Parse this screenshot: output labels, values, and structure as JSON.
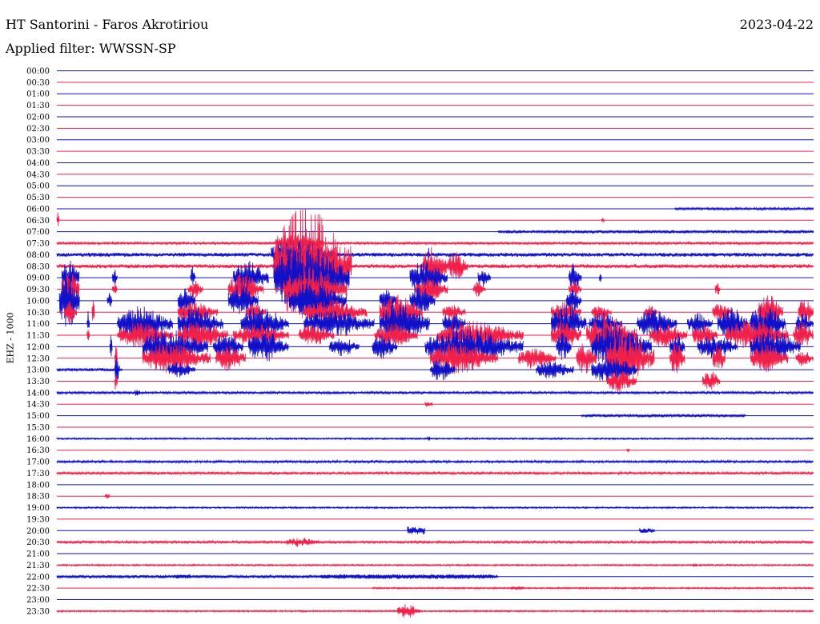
{
  "header": {
    "title": "HT Santorini - Faros Akrotiriou",
    "date": "2023-04-22",
    "filter": "Applied filter: WWSSN-SP"
  },
  "colors": {
    "even_trace": "#1010c8",
    "odd_trace": "#f0204a",
    "background": "#ffffff"
  },
  "chart_data": {
    "type": "line",
    "title": "HT Santorini - Faros Akrotiriou",
    "subtitle": "Applied filter: WWSSN-SP",
    "date": "2023-04-22",
    "ylabel": "EHZ - 1000",
    "row_labels": [
      "00:00",
      "00:30",
      "01:00",
      "01:30",
      "02:00",
      "02:30",
      "03:00",
      "03:30",
      "04:00",
      "04:30",
      "05:00",
      "05:30",
      "06:00",
      "06:30",
      "07:00",
      "07:30",
      "08:00",
      "08:30",
      "09:00",
      "09:30",
      "10:00",
      "10:30",
      "11:00",
      "11:30",
      "12:00",
      "12:30",
      "13:00",
      "13:30",
      "14:00",
      "14:30",
      "15:00",
      "15:30",
      "16:00",
      "16:30",
      "17:00",
      "17:30",
      "18:00",
      "18:30",
      "19:00",
      "19:30",
      "20:00",
      "20:30",
      "21:00",
      "21:30",
      "22:00",
      "22:30",
      "23:00",
      "23:30"
    ],
    "x_range_minutes": [
      0,
      30
    ],
    "grid": false,
    "legend": "none",
    "series": [
      {
        "row": "00:00",
        "bursts": []
      },
      {
        "row": "00:30",
        "bursts": []
      },
      {
        "row": "01:00",
        "bursts": []
      },
      {
        "row": "01:30",
        "bursts": []
      },
      {
        "row": "02:00",
        "bursts": []
      },
      {
        "row": "02:30",
        "bursts": []
      },
      {
        "row": "03:00",
        "bursts": []
      },
      {
        "row": "03:30",
        "bursts": []
      },
      {
        "row": "04:00",
        "bursts": []
      },
      {
        "row": "04:30",
        "bursts": []
      },
      {
        "row": "05:00",
        "bursts": []
      },
      {
        "row": "05:30",
        "bursts": []
      },
      {
        "row": "06:00",
        "bursts": [
          [
            24.5,
            30,
            1.5
          ]
        ]
      },
      {
        "row": "06:30",
        "bursts": [
          [
            0,
            0.1,
            10
          ],
          [
            21.6,
            21.7,
            3
          ]
        ]
      },
      {
        "row": "07:00",
        "bursts": [
          [
            17.5,
            30,
            2
          ]
        ]
      },
      {
        "row": "07:30",
        "bursts": [
          [
            0,
            30,
            1.5
          ],
          [
            8.7,
            10.6,
            12
          ]
        ]
      },
      {
        "row": "08:00",
        "bursts": [
          [
            0,
            30,
            2.5
          ],
          [
            8.5,
            11,
            20
          ],
          [
            14.7,
            14.8,
            10
          ]
        ]
      },
      {
        "row": "08:30",
        "bursts": [
          [
            0,
            30,
            2.5
          ],
          [
            8.6,
            11.7,
            75
          ],
          [
            14.5,
            15.5,
            25
          ],
          [
            15.5,
            16.3,
            18
          ]
        ]
      },
      {
        "row": "09:00",
        "bursts": [
          [
            0.2,
            0.9,
            22
          ],
          [
            2.2,
            2.4,
            12
          ],
          [
            5.3,
            5.5,
            14
          ],
          [
            7,
            8.4,
            22
          ],
          [
            8.6,
            11.6,
            45
          ],
          [
            14,
            15.5,
            22
          ],
          [
            16.7,
            17.2,
            15
          ],
          [
            20.3,
            20.8,
            20
          ],
          [
            21.5,
            21.6,
            6
          ]
        ]
      },
      {
        "row": "09:30",
        "bursts": [
          [
            0.2,
            0.9,
            30
          ],
          [
            2.2,
            2.4,
            10
          ],
          [
            5.2,
            5.8,
            12
          ],
          [
            6.8,
            8.2,
            20
          ],
          [
            9,
            11.5,
            30
          ],
          [
            14.2,
            15.5,
            16
          ],
          [
            16.5,
            17,
            10
          ],
          [
            20.3,
            20.8,
            12
          ],
          [
            26.1,
            26.3,
            10
          ]
        ]
      },
      {
        "row": "10:00",
        "bursts": [
          [
            0.1,
            0.9,
            36
          ],
          [
            2,
            2.2,
            10
          ],
          [
            4.8,
            5.5,
            18
          ],
          [
            6.8,
            8,
            22
          ],
          [
            9.2,
            11.5,
            25
          ],
          [
            12.8,
            13.5,
            16
          ],
          [
            14,
            15,
            20
          ],
          [
            20.2,
            20.8,
            16
          ]
        ]
      },
      {
        "row": "10:30",
        "bursts": [
          [
            0.3,
            0.8,
            14
          ],
          [
            1.4,
            1.5,
            18
          ],
          [
            4.8,
            6.4,
            14
          ],
          [
            7.5,
            8.3,
            12
          ],
          [
            9.8,
            12.3,
            16
          ],
          [
            12.8,
            14.5,
            24
          ],
          [
            15.3,
            16.2,
            12
          ],
          [
            19.6,
            20.8,
            14
          ],
          [
            21.2,
            22,
            10
          ],
          [
            23.3,
            23.8,
            10
          ],
          [
            26,
            26.8,
            12
          ],
          [
            27.8,
            28.8,
            22
          ],
          [
            29.4,
            30,
            18
          ]
        ]
      },
      {
        "row": "11:00",
        "bursts": [
          [
            1.2,
            1.3,
            16
          ],
          [
            2.4,
            4.6,
            22
          ],
          [
            4.8,
            6.6,
            20
          ],
          [
            7.3,
            9.2,
            22
          ],
          [
            9.8,
            12.6,
            18
          ],
          [
            12.8,
            14.8,
            26
          ],
          [
            15.3,
            16.2,
            16
          ],
          [
            19.6,
            21,
            24
          ],
          [
            21.1,
            22.4,
            14
          ],
          [
            23,
            24.6,
            18
          ],
          [
            25,
            26,
            14
          ],
          [
            26.2,
            27.4,
            22
          ],
          [
            27.5,
            28.9,
            26
          ],
          [
            29.3,
            30,
            14
          ]
        ]
      },
      {
        "row": "11:30",
        "bursts": [
          [
            1.2,
            1.3,
            10
          ],
          [
            2.4,
            4.6,
            16
          ],
          [
            4.8,
            6.8,
            18
          ],
          [
            7,
            9.2,
            14
          ],
          [
            9.6,
            11,
            14
          ],
          [
            12.6,
            14.3,
            16
          ],
          [
            15.1,
            18.5,
            18
          ],
          [
            19.6,
            20.8,
            20
          ],
          [
            21,
            23,
            26
          ],
          [
            23.5,
            25,
            16
          ],
          [
            25.2,
            26.2,
            14
          ],
          [
            26.5,
            29,
            20
          ],
          [
            29.2,
            30,
            18
          ]
        ]
      },
      {
        "row": "12:00",
        "bursts": [
          [
            2.1,
            2.2,
            20
          ],
          [
            3.4,
            6,
            22
          ],
          [
            6.2,
            7.4,
            16
          ],
          [
            7.6,
            9.2,
            20
          ],
          [
            10.8,
            12,
            12
          ],
          [
            12.5,
            13.5,
            16
          ],
          [
            14.6,
            18.5,
            22
          ],
          [
            19.8,
            20.4,
            20
          ],
          [
            21.2,
            23.6,
            28
          ],
          [
            24.3,
            24.9,
            18
          ],
          [
            25.4,
            27,
            16
          ],
          [
            27.5,
            29.5,
            22
          ]
        ]
      },
      {
        "row": "12:30",
        "bursts": [
          [
            2.3,
            2.4,
            24
          ],
          [
            3.4,
            6.1,
            20
          ],
          [
            6.3,
            7.5,
            18
          ],
          [
            14.8,
            17.5,
            20
          ],
          [
            18.3,
            19.8,
            14
          ],
          [
            20.6,
            21.4,
            20
          ],
          [
            21.8,
            23.7,
            34
          ],
          [
            24.3,
            24.9,
            22
          ],
          [
            26,
            26.5,
            20
          ],
          [
            27.5,
            29,
            18
          ],
          [
            29.3,
            30,
            10
          ]
        ]
      },
      {
        "row": "13:00",
        "bursts": [
          [
            0,
            2.6,
            2
          ],
          [
            2.3,
            2.5,
            16
          ],
          [
            4.4,
            5.5,
            10
          ],
          [
            14.8,
            15.8,
            14
          ],
          [
            19,
            20.5,
            12
          ],
          [
            21.2,
            23,
            18
          ]
        ]
      },
      {
        "row": "13:30",
        "bursts": [
          [
            2.3,
            2.4,
            16
          ],
          [
            21.8,
            23,
            14
          ],
          [
            25.6,
            26.3,
            14
          ]
        ]
      },
      {
        "row": "14:00",
        "bursts": [
          [
            0,
            30,
            1.5
          ],
          [
            3.1,
            3.3,
            4
          ]
        ]
      },
      {
        "row": "14:30",
        "bursts": [
          [
            14.6,
            14.9,
            3
          ]
        ]
      },
      {
        "row": "15:00",
        "bursts": [
          [
            20.8,
            27.3,
            2
          ]
        ]
      },
      {
        "row": "15:30",
        "bursts": []
      },
      {
        "row": "16:00",
        "bursts": [
          [
            0,
            30,
            1
          ],
          [
            14.7,
            14.8,
            3
          ]
        ]
      },
      {
        "row": "16:30",
        "bursts": [
          [
            22.6,
            22.7,
            3
          ]
        ]
      },
      {
        "row": "17:00",
        "bursts": [
          [
            0,
            30,
            1.5
          ]
        ]
      },
      {
        "row": "17:30",
        "bursts": [
          [
            0,
            30,
            1.5
          ]
        ]
      },
      {
        "row": "18:00",
        "bursts": []
      },
      {
        "row": "18:30",
        "bursts": [
          [
            1.9,
            2.1,
            3
          ]
        ]
      },
      {
        "row": "19:00",
        "bursts": [
          [
            0,
            30,
            1
          ]
        ]
      },
      {
        "row": "19:30",
        "bursts": []
      },
      {
        "row": "20:00",
        "bursts": [
          [
            13.9,
            14.6,
            5
          ],
          [
            23.1,
            23.7,
            3
          ]
        ]
      },
      {
        "row": "20:30",
        "bursts": [
          [
            0,
            30,
            1.5
          ],
          [
            9.1,
            10.4,
            6
          ]
        ]
      },
      {
        "row": "21:00",
        "bursts": []
      },
      {
        "row": "21:30",
        "bursts": [
          [
            0,
            30,
            1
          ],
          [
            25.2,
            25.4,
            2
          ]
        ]
      },
      {
        "row": "22:00",
        "bursts": [
          [
            0,
            17.5,
            2
          ],
          [
            4.7,
            5.3,
            3
          ],
          [
            10.5,
            17.3,
            3
          ]
        ]
      },
      {
        "row": "22:30",
        "bursts": [
          [
            12.5,
            30,
            1
          ],
          [
            18,
            18.5,
            2
          ]
        ]
      },
      {
        "row": "23:00",
        "bursts": []
      },
      {
        "row": "23:30",
        "bursts": [
          [
            0,
            30,
            1
          ],
          [
            13.5,
            14.4,
            9
          ]
        ]
      }
    ]
  }
}
